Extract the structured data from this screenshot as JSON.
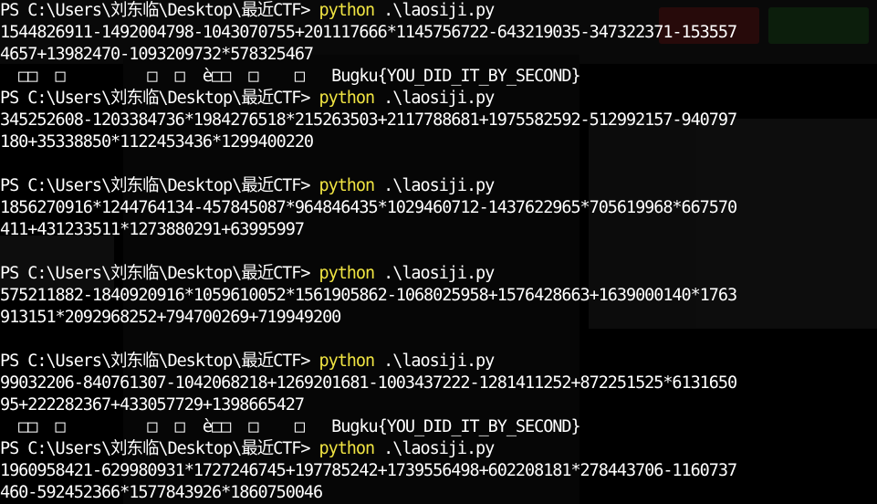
{
  "prompt": "PS C:\\Users\\刘东临\\Desktop\\最近CTF>",
  "command_name": "python",
  "command_args": ".\\laosiji.py",
  "garbage_prefix": "  □□  □         □  □  è□□  □    □   ",
  "flag_text": "Bugku{YOU_DID_IT_BY_SECOND}",
  "runs": [
    {
      "expression_lines": [
        "1544826911-1492004798-1043070755+201117666*1145756722-643219035-347322371-153557",
        "4657+13982470-1093209732*578325467"
      ],
      "flag": true
    },
    {
      "expression_lines": [
        "345252608-1203384736*1984276518*215263503+2117788681+1975582592-512992157-940797",
        "180+35338850*1122453436*1299400220"
      ],
      "flag": false,
      "blank_after": true
    },
    {
      "expression_lines": [
        "1856270916*1244764134-457845087*964846435*1029460712-1437622965*705619968*667570",
        "411+431233511*1273880291+63995997"
      ],
      "flag": false,
      "blank_after": true
    },
    {
      "expression_lines": [
        "575211882-1840920916*1059610052*1561905862-1068025958+1576428663+1639000140*1763",
        "913151*2092968252+794700269+719949200"
      ],
      "flag": false,
      "blank_after": true
    },
    {
      "expression_lines": [
        "99032206-840761307-1042068218+1269201681-1003437222-1281411252+872251525*6131650",
        "95+222282367+433057729+1398665427"
      ],
      "flag": true
    },
    {
      "expression_lines": [
        "1960958421-629980931*1727246745+197785242+1739556498+602208181*278443706-1160737",
        "460-592452366*1577843926*1860750046"
      ],
      "flag": false
    }
  ]
}
